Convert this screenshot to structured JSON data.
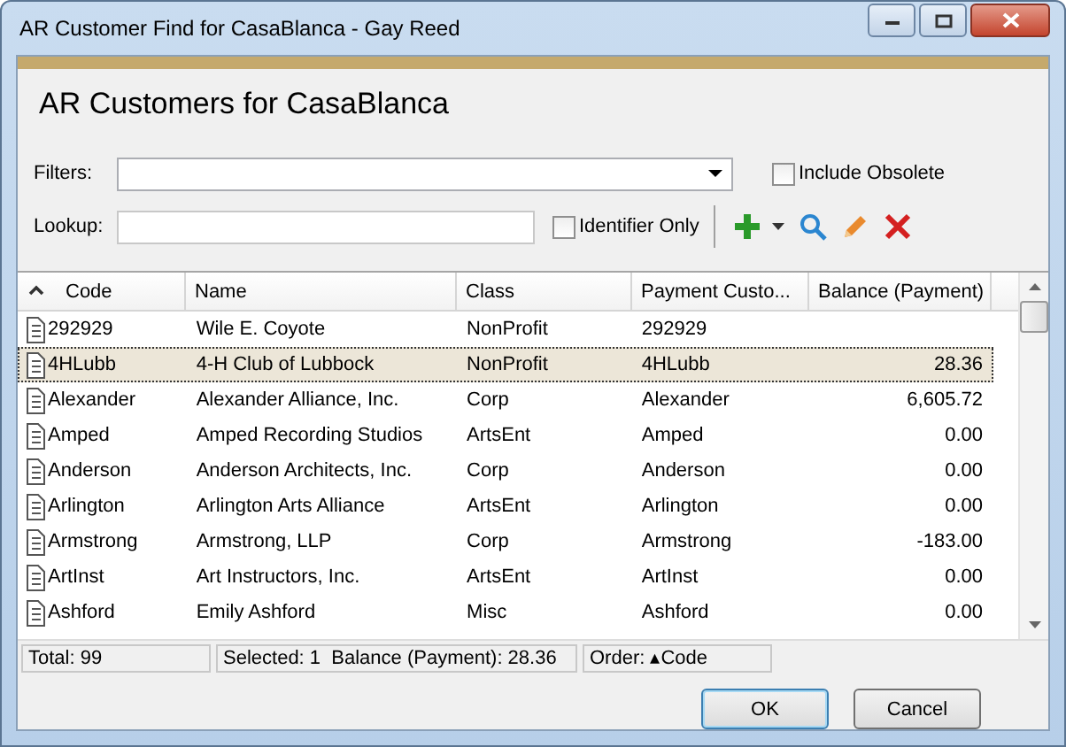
{
  "window": {
    "title": "AR Customer Find for CasaBlanca - Gay Reed"
  },
  "heading": "AR Customers for CasaBlanca",
  "filters": {
    "label": "Filters:"
  },
  "include_obsolete": {
    "label": "Include Obsolete",
    "checked": false
  },
  "lookup": {
    "label": "Lookup:"
  },
  "identifier_only": {
    "label": "Identifier Only",
    "checked": false
  },
  "table": {
    "columns": [
      {
        "label": "Code",
        "sorted": true
      },
      {
        "label": "Name",
        "sorted": false
      },
      {
        "label": "Class",
        "sorted": false
      },
      {
        "label": "Payment Custo...",
        "sorted": false
      },
      {
        "label": "Balance (Payment)",
        "sorted": false
      }
    ],
    "rows": [
      {
        "cells": [
          "292929",
          "Wile E. Coyote",
          "NonProfit",
          "292929",
          ""
        ],
        "selected": false
      },
      {
        "cells": [
          "4HLubb",
          "4-H Club of Lubbock",
          "NonProfit",
          "4HLubb",
          "28.36"
        ],
        "selected": true
      },
      {
        "cells": [
          "Alexander",
          "Alexander Alliance, Inc.",
          "Corp",
          "Alexander",
          "6,605.72"
        ],
        "selected": false
      },
      {
        "cells": [
          "Amped",
          "Amped Recording Studios",
          "ArtsEnt",
          "Amped",
          "0.00"
        ],
        "selected": false
      },
      {
        "cells": [
          "Anderson",
          "Anderson Architects, Inc.",
          "Corp",
          "Anderson",
          "0.00"
        ],
        "selected": false
      },
      {
        "cells": [
          "Arlington",
          "Arlington Arts Alliance",
          "ArtsEnt",
          "Arlington",
          "0.00"
        ],
        "selected": false
      },
      {
        "cells": [
          "Armstrong",
          "Armstrong, LLP",
          "Corp",
          "Armstrong",
          "-183.00"
        ],
        "selected": false
      },
      {
        "cells": [
          "ArtInst",
          "Art Instructors, Inc.",
          "ArtsEnt",
          "ArtInst",
          "0.00"
        ],
        "selected": false
      },
      {
        "cells": [
          "Ashford",
          "Emily Ashford",
          "Misc",
          "Ashford",
          "0.00"
        ],
        "selected": false
      }
    ]
  },
  "status_bar": [
    "Total: 99",
    "Selected: 1  Balance (Payment): 28.36",
    "Order: ▴Code"
  ],
  "buttons": [
    {
      "label": "OK",
      "default": true
    },
    {
      "label": "Cancel",
      "default": false
    }
  ]
}
